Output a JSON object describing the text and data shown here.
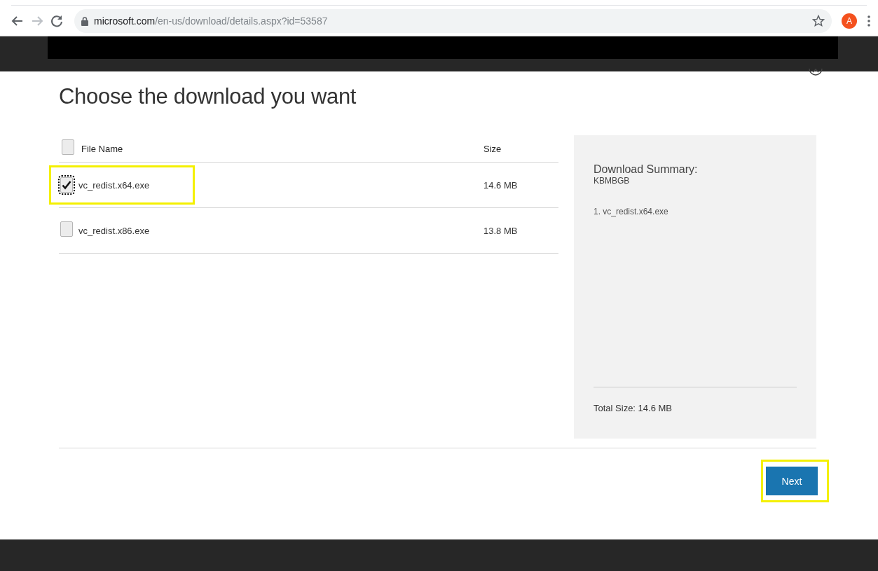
{
  "browser": {
    "url_host": "microsoft.com",
    "url_path": "/en-us/download/details.aspx?id=53587",
    "profile_initial": "A"
  },
  "dialog": {
    "title": "Choose the download you want",
    "columns": [
      "File Name",
      "Size"
    ],
    "select_all_checked": false,
    "files": [
      {
        "name": "vc_redist.x64.exe",
        "size": "14.6 MB",
        "checked": true,
        "focused": true,
        "highlighted": true
      },
      {
        "name": "vc_redist.x86.exe",
        "size": "13.8 MB",
        "checked": false,
        "focused": false,
        "highlighted": false
      }
    ],
    "summary": {
      "heading": "Download Summary:",
      "subheading": "KBMBGB",
      "items": [
        "1. vc_redist.x64.exe"
      ],
      "total": "Total Size: 14.6 MB"
    },
    "next_button": {
      "label": "Next",
      "highlighted": true
    }
  }
}
